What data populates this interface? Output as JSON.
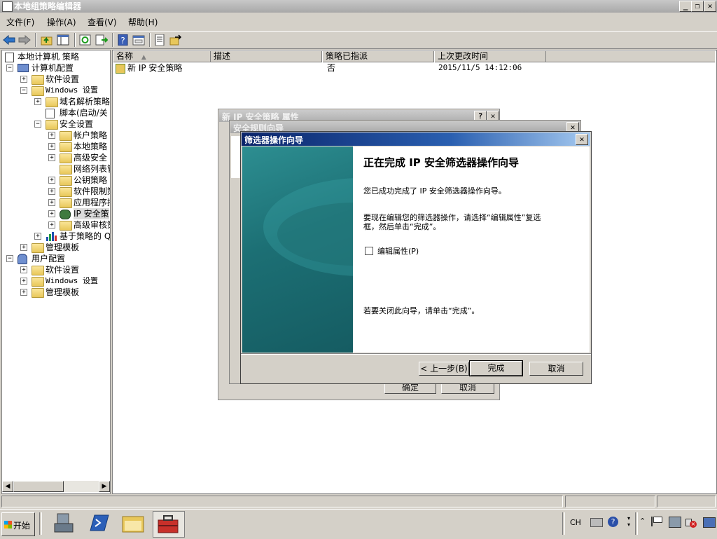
{
  "window": {
    "title": "本地组策略编辑器",
    "controls": {
      "minimize": "_",
      "restore": "❐",
      "close": "✕"
    }
  },
  "menu": [
    "文件(F)",
    "操作(A)",
    "查看(V)",
    "帮助(H)"
  ],
  "toolbar": [
    "back-icon",
    "forward-icon",
    "up-folder-icon",
    "show-hide-tree-icon",
    "refresh-icon",
    "export-list-icon",
    "help-icon",
    "properties-icon",
    "policy-icon",
    "assign-icon"
  ],
  "tree": {
    "root": "本地计算机 策略",
    "computer_config": "计算机配置",
    "software_settings": "软件设置",
    "windows_settings": "Windows 设置",
    "name_resolution": "域名解析策略",
    "scripts": "脚本(启动/关",
    "security_settings": "安全设置",
    "account_policies": "帐户策略",
    "local_policies": "本地策略",
    "advanced_security": "高级安全",
    "network_list": "网络列表管",
    "public_key": "公钥策略",
    "software_restriction": "软件限制策",
    "app_control": "应用程序控",
    "ip_security": "IP 安全策",
    "advanced_audit": "高级审核策",
    "qos": "基于策略的 Q",
    "admin_templates_1": "管理模板",
    "user_config": "用户配置",
    "user_software": "软件设置",
    "user_windows": "Windows 设置",
    "admin_templates_2": "管理模板"
  },
  "list": {
    "columns": [
      "名称",
      "描述",
      "策略已指派",
      "上次更改时间"
    ],
    "rows": [
      {
        "name": "新 IP 安全策略",
        "description": "",
        "assigned": "否",
        "modified": "2015/11/5 14:12:06"
      }
    ]
  },
  "dialog_back1": {
    "title": "新 IP 安全策略 属性",
    "help": "?",
    "close": "✕",
    "ok": "确定",
    "cancel": "取消"
  },
  "dialog_back2": {
    "title": "安全规则向导",
    "close": "✕"
  },
  "wizard": {
    "title": "筛选器操作向导",
    "close": "✕",
    "heading": "正在完成 IP 安全筛选器操作向导",
    "line1": "您已成功完成了 IP 安全筛选器操作向导。",
    "line2a": "要现在编辑您的筛选器操作，请选择“编辑属性”复选",
    "line2b": "框，然后单击“完成”。",
    "checkbox_label": "编辑属性(P)",
    "checkbox_checked": false,
    "line3": "若要关闭此向导，请单击“完成”。",
    "back": "< 上一步(B)",
    "finish": "完成",
    "cancel": "取消"
  },
  "taskbar": {
    "start": "开始",
    "lang": "CH",
    "apps": [
      "server-manager-icon",
      "powershell-icon",
      "explorer-icon",
      "toolbox-icon"
    ],
    "tray": [
      "keyboard-icon",
      "help-icon",
      "arrow-icon",
      "flag-icon",
      "network-icon",
      "volume-muted-icon",
      "show-desktop-icon"
    ]
  },
  "colors": {
    "accent": "#0a246a",
    "wizard_panel": "#1f7f84",
    "face": "#d4d0c8"
  }
}
